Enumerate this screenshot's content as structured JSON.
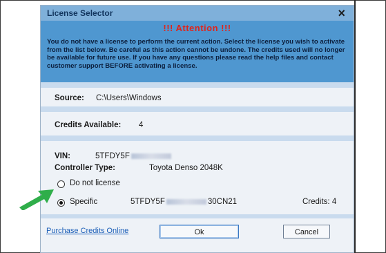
{
  "dialog": {
    "title": "License Selector",
    "close_glyph": "×",
    "attention": "!!!  Attention  !!!",
    "warning": "You do not have a license to perform the current action. Select the license you wish to activate from the list below. Be careful as this action cannot be undone. The credits used will no longer be available for future use. If you have any questions please read the help files and contact customer support BEFORE activating a license."
  },
  "source": {
    "label": "Source:",
    "value": "C:\\Users\\Windows"
  },
  "credits": {
    "label": "Credits Available:",
    "value": "4"
  },
  "vehicle": {
    "vin_label": "VIN:",
    "vin_prefix": "5TFDY5F",
    "controller_label": "Controller Type:",
    "controller_value": "Toyota Denso 2048K"
  },
  "options": {
    "do_not_license": {
      "label": "Do not license",
      "selected": false
    },
    "specific": {
      "label": "Specific",
      "selected": true,
      "license_prefix": "5TFDY5F",
      "license_suffix": "30CN21",
      "credits_text": "Credits: 4"
    }
  },
  "footer": {
    "purchase_link": "Purchase Credits Online",
    "ok_label": "Ok",
    "cancel_label": "Cancel"
  },
  "colors": {
    "titlebar": "#7fb0da",
    "warning_panel": "#4f97d0",
    "attention_red": "#e0241b",
    "arrow_green": "#2fae4a"
  },
  "icons": [
    "close-icon",
    "radio-icon",
    "green-arrow-icon"
  ]
}
